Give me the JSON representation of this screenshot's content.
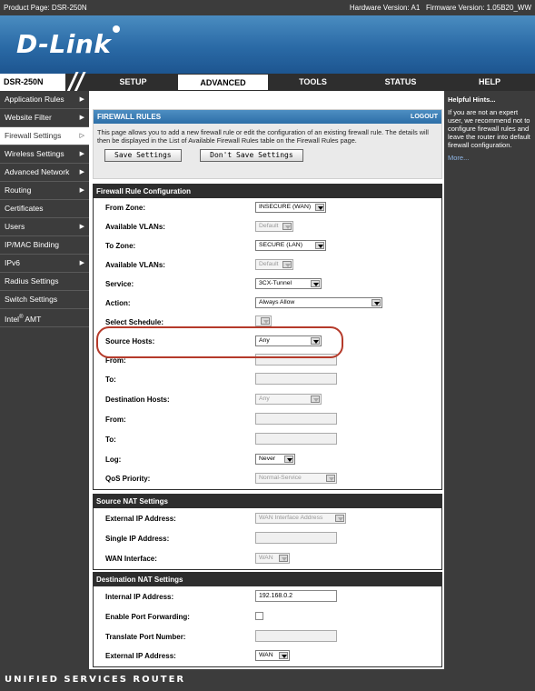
{
  "header": {
    "product_page": "Product Page: DSR-250N",
    "hardware_version": "Hardware Version: A1",
    "firmware_version": "Firmware Version: 1.05B20_WW",
    "logo": "D-Link",
    "model": "DSR-250N"
  },
  "nav": {
    "tabs": [
      {
        "label": "SETUP",
        "active": false
      },
      {
        "label": "ADVANCED",
        "active": true
      },
      {
        "label": "TOOLS",
        "active": false
      },
      {
        "label": "STATUS",
        "active": false
      },
      {
        "label": "HELP",
        "active": false
      }
    ]
  },
  "sidebar": {
    "items": [
      {
        "label": "Application Rules",
        "arrow": true,
        "active": false
      },
      {
        "label": "Website Filter",
        "arrow": true,
        "active": false
      },
      {
        "label": "Firewall Settings",
        "arrow": true,
        "active": true
      },
      {
        "label": "Wireless Settings",
        "arrow": true,
        "active": false
      },
      {
        "label": "Advanced Network",
        "arrow": true,
        "active": false
      },
      {
        "label": "Routing",
        "arrow": true,
        "active": false
      },
      {
        "label": "Certificates",
        "arrow": false,
        "active": false
      },
      {
        "label": "Users",
        "arrow": true,
        "active": false
      },
      {
        "label": "IP/MAC Binding",
        "arrow": false,
        "active": false
      },
      {
        "label": "IPv6",
        "arrow": true,
        "active": false
      },
      {
        "label": "Radius Settings",
        "arrow": false,
        "active": false
      },
      {
        "label": "Switch Settings",
        "arrow": false,
        "active": false
      },
      {
        "label": "Intel",
        "sup": "®",
        "suffix": " AMT",
        "arrow": false,
        "active": false
      }
    ]
  },
  "help": {
    "title": "Helpful Hints...",
    "text": "If you are not an expert user, we recommend not to configure firewall rules and leave the router into default firewall configuration.",
    "more": "More..."
  },
  "firewall_rules": {
    "title": "FIREWALL RULES",
    "logout": "LOGOUT",
    "description": "This page allows you to add a new firewall rule or edit the configuration of an existing firewall rule. The details will then be displayed in the List of Available Firewall Rules table on the Firewall Rules page.",
    "save_label": "Save Settings",
    "dont_save_label": "Don't Save Settings"
  },
  "rule_config": {
    "title": "Firewall Rule Configuration",
    "from_zone": {
      "label": "From Zone:",
      "value": "INSECURE (WAN)"
    },
    "from_vlans": {
      "label": "Available VLANs:",
      "value": "Default"
    },
    "to_zone": {
      "label": "To Zone:",
      "value": "SECURE (LAN)"
    },
    "to_vlans": {
      "label": "Available VLANs:",
      "value": "Default"
    },
    "service": {
      "label": "Service:",
      "value": "3CX-Tunnel"
    },
    "action": {
      "label": "Action:",
      "value": "Always Allow"
    },
    "schedule": {
      "label": "Select Schedule:",
      "value": ""
    },
    "source_hosts": {
      "label": "Source Hosts:",
      "value": "Any"
    },
    "source_from": {
      "label": "From:",
      "value": ""
    },
    "source_to": {
      "label": "To:",
      "value": ""
    },
    "dest_hosts": {
      "label": "Destination Hosts:",
      "value": "Any"
    },
    "dest_from": {
      "label": "From:",
      "value": ""
    },
    "dest_to": {
      "label": "To:",
      "value": ""
    },
    "log": {
      "label": "Log:",
      "value": "Never"
    },
    "qos": {
      "label": "QoS Priority:",
      "value": "Normal-Service"
    }
  },
  "source_nat": {
    "title": "Source NAT Settings",
    "external_ip": {
      "label": "External IP Address:",
      "value": "WAN Interface Address"
    },
    "single_ip": {
      "label": "Single IP Address:",
      "value": ""
    },
    "wan_interface": {
      "label": "WAN Interface:",
      "value": "WAN"
    }
  },
  "dest_nat": {
    "title": "Destination NAT Settings",
    "internal_ip": {
      "label": "Internal IP Address:",
      "value": "192.168.0.2"
    },
    "port_forwarding": {
      "label": "Enable Port Forwarding:",
      "checked": false
    },
    "translate_port": {
      "label": "Translate Port Number:",
      "value": ""
    },
    "external_ip": {
      "label": "External IP Address:",
      "value": "WAN"
    }
  },
  "footer": {
    "text": "UNIFIED SERVICES ROUTER"
  }
}
